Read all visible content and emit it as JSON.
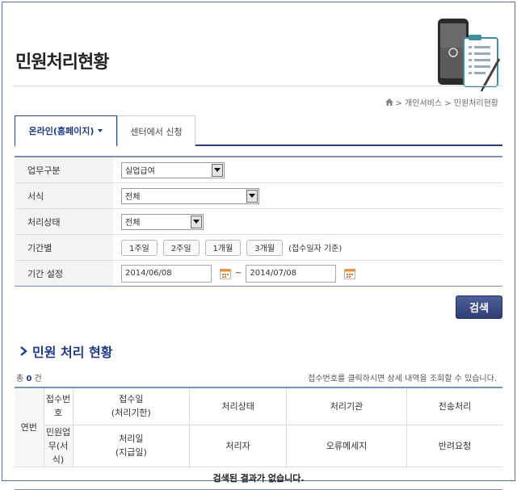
{
  "page": {
    "title": "민원처리현황"
  },
  "breadcrumb": {
    "text": "> 개인서비스 > 민원처리현황"
  },
  "tabs": [
    {
      "label": "온라인(홈페이지)",
      "active": true
    },
    {
      "label": "센터에서 신청",
      "active": false
    }
  ],
  "form": {
    "business": {
      "label": "업무구분",
      "value": "실업급여"
    },
    "format": {
      "label": "서식",
      "value": "전체"
    },
    "status": {
      "label": "처리상태",
      "value": "전체"
    },
    "period": {
      "label": "기간별",
      "buttons": [
        "1주일",
        "2주일",
        "1개월",
        "3개월"
      ],
      "note": "(접수일자 기준)"
    },
    "range": {
      "label": "기간 설정",
      "start": "2014/06/08",
      "separator": "~",
      "end": "2014/07/08"
    }
  },
  "search_button": "검색",
  "results": {
    "title": "민원 처리 현황",
    "total_prefix": "총",
    "total_count": "0",
    "total_suffix": "건",
    "hint": "접수번호를 클릭하시면 상세 내역을 조회할 수 있습니다.",
    "headers": {
      "seq": "연번",
      "row1": [
        "접수번호",
        "접수일\n(처리기한)",
        "처리상태",
        "처리기관",
        "전송처리"
      ],
      "row2": [
        "민원업무(서식)",
        "처리일\n(지급일)",
        "처리자",
        "오류메세지",
        "반려요청"
      ]
    },
    "empty": "검색된 결과가 없습니다."
  },
  "colors": {
    "navy": "#2b3f78",
    "accent": "#1f3b88",
    "button": "#3c4c86"
  }
}
